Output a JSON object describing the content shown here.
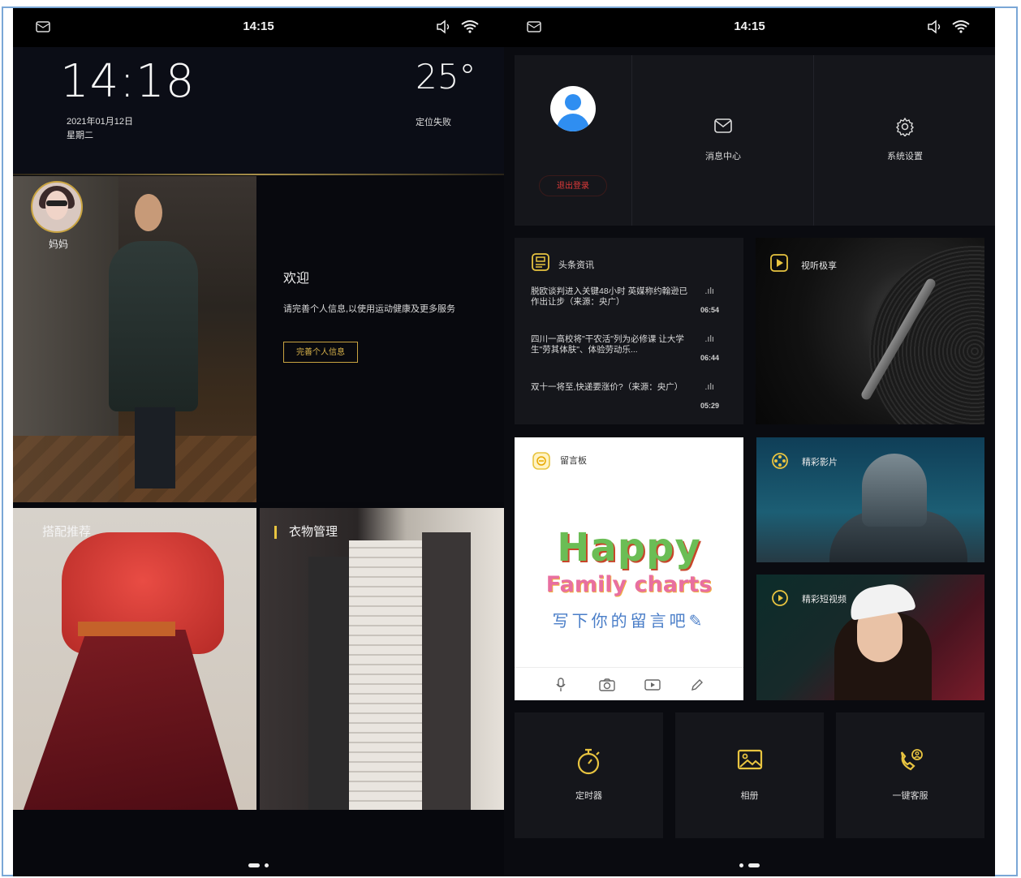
{
  "left_screen": {
    "status_time": "14:15",
    "clock": "14:18",
    "date": "2021年01月12日",
    "weekday": "星期二",
    "temperature": "25°",
    "location_status": "定位失败",
    "profile_name": "妈妈",
    "welcome_title": "欢迎",
    "welcome_subtitle": "请完善个人信息,以使用运动健康及更多服务",
    "complete_button": "完善个人信息",
    "tile_outfit": "搭配推荐",
    "tile_wardrobe": "衣物管理",
    "page_index": 1,
    "page_count": 2
  },
  "right_screen": {
    "status_time": "14:15",
    "logout_button": "退出登录",
    "message_center": "消息中心",
    "system_settings": "系统设置",
    "news": {
      "title": "头条资讯",
      "items": [
        {
          "text": "脱欧谈判进入关键48小时 英媒称约翰逊已作出让步（来源：央广）",
          "duration": "06:54"
        },
        {
          "text": "四川一高校将\"干农活\"列为必修课 让大学生\"劳其体肤\"、体验劳动乐...",
          "duration": "06:44"
        },
        {
          "text": "双十一将至,快递要涨价?（来源：央广）",
          "duration": "05:29"
        }
      ]
    },
    "audio_tile": "视听极享",
    "memo_board": {
      "title": "留言板",
      "art_line1": "Happy",
      "art_line2": "Family charts",
      "art_line3": "写下你的留言吧"
    },
    "movies_tile": "精彩影片",
    "short_video_tile": "精彩短视频",
    "tools": [
      {
        "label": "定时器",
        "icon": "stopwatch-icon"
      },
      {
        "label": "相册",
        "icon": "photo-album-icon"
      },
      {
        "label": "一键客服",
        "icon": "customer-service-phone-icon"
      }
    ],
    "page_index": 2,
    "page_count": 2
  },
  "colors": {
    "accent_gold": "#c9a441",
    "accent_yellow": "#e8c440",
    "logout_red": "#e03a3a",
    "avatar_blue": "#2f8ef1"
  }
}
